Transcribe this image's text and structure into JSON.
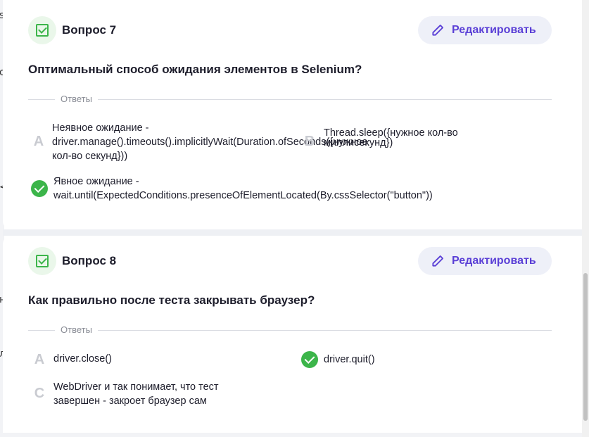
{
  "cards": [
    {
      "title": "Вопрос 7",
      "edit_label": "Редактировать",
      "question": "Оптимальный способ ожидания элементов в Selenium?",
      "answers_label": "Ответы",
      "answers": [
        {
          "letter": "A",
          "text": "Неявное ожидание - driver.manage().timeouts().implicitlyWait(Duration.ofSeconds({нужное кол-во секунд}))",
          "correct": false
        },
        {
          "letter": "B",
          "text": "Thread.sleep({нужное кол-во миллисекунд})",
          "correct": false
        },
        {
          "letter": "",
          "text": "Явное ожидание - wait.until(ExpectedConditions.presenceOfElementLocated(By.cssSelector(\"button\"))",
          "correct": true
        }
      ]
    },
    {
      "title": "Вопрос 8",
      "edit_label": "Редактировать",
      "question": "Как правильно после теста закрывать браузер?",
      "answers_label": "Ответы",
      "answers": [
        {
          "letter": "A",
          "text": "driver.close()",
          "correct": false
        },
        {
          "letter": "",
          "text": "driver.quit()",
          "correct": true
        },
        {
          "letter": "C",
          "text": "WebDriver и так понимает, что тест завершен - закроет браузер сам",
          "correct": false
        }
      ]
    }
  ],
  "colors": {
    "accent": "#5a3fd6",
    "success": "#3cb54a"
  },
  "icons": {
    "edit": "pencil-icon",
    "question": "checkbox-icon",
    "correct": "check-circle-icon"
  }
}
